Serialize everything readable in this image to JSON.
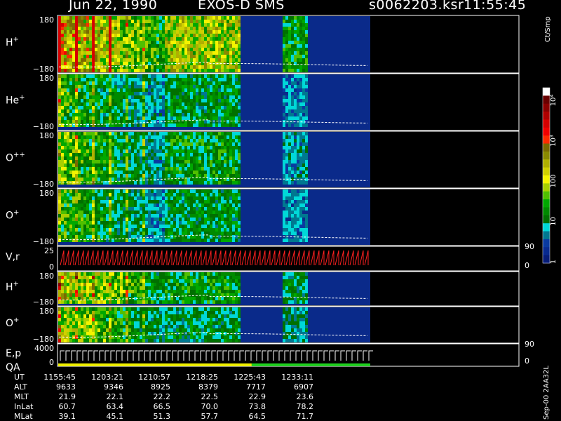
{
  "header": {
    "date": "Jun 22, 1990",
    "instrument": "EXOS-D SMS",
    "file": "s0062203.ksr",
    "time": "11:55:45"
  },
  "colorbar": {
    "title": "Ct/Smp",
    "tick_labels": [
      "10⁴",
      "10³",
      "100",
      "10",
      "1"
    ],
    "colors": [
      "#ffffff",
      "#6a0000",
      "#8a0000",
      "#b00000",
      "#d60000",
      "#f20000",
      "#ff2a00",
      "#7a6a00",
      "#8a8a00",
      "#b0b000",
      "#d0d000",
      "#f4f400",
      "#a8d000",
      "#50c000",
      "#00a800",
      "#008a00",
      "#007000",
      "#00d8d8",
      "#007890",
      "#0a3aa0",
      "#082a90",
      "#061c78"
    ]
  },
  "colors": {
    "background": "#0a2a8a",
    "dark_blue": "#10106a",
    "navy": "#081868",
    "trace": "#ffffff",
    "vr_trace": "#ff2020",
    "qa_yellow": "#f0f000",
    "qa_green": "#20d020"
  },
  "chart_data": {
    "type": "heatmap",
    "panels": [
      {
        "label": "H",
        "superscript": "+",
        "ytop": "180",
        "ybot": "−180",
        "kind": "spectro",
        "activity": 1.0
      },
      {
        "label": "He",
        "superscript": "+",
        "ytop": "180",
        "ybot": "−180",
        "kind": "spectro",
        "activity": 0.55
      },
      {
        "label": "O",
        "superscript": "++",
        "ytop": "180",
        "ybot": "−180",
        "kind": "spectro",
        "activity": 0.6
      },
      {
        "label": "O",
        "superscript": "+",
        "ytop": "180",
        "ybot": "−180",
        "kind": "spectro",
        "activity": 0.55
      },
      {
        "label": "V,r",
        "superscript": "",
        "ytop": "25",
        "ybot": "0",
        "kind": "vr",
        "activity": 0
      },
      {
        "label": "H",
        "superscript": "+",
        "ytop": "180",
        "ybot": "−180",
        "kind": "spectro2",
        "activity": 0.85
      },
      {
        "label": "O",
        "superscript": "+",
        "ytop": "180",
        "ybot": "−180",
        "kind": "spectro2",
        "activity": 0.7
      },
      {
        "label": "E,p",
        "label2": "QA",
        "superscript": "",
        "ytop": "4000",
        "ybot": "0",
        "kind": "ep",
        "activity": 0
      }
    ],
    "right_axis_labels": [
      {
        "panel": 4,
        "top": "90",
        "bottom": "0"
      },
      {
        "panel": 7,
        "top": "90",
        "bottom": "0"
      }
    ],
    "ephemeris": {
      "row_labels": [
        "UT",
        "ALT",
        "MLT",
        "InLat",
        "MLat"
      ],
      "columns": [
        [
          "1155:45",
          "9633",
          "21.9",
          "60.7",
          "39.1"
        ],
        [
          "1203:21",
          "9346",
          "22.1",
          "63.4",
          "45.1"
        ],
        [
          "1210:57",
          "8925",
          "22.2",
          "66.5",
          "51.3"
        ],
        [
          "1218:25",
          "8379",
          "22.5",
          "70.0",
          "57.7"
        ],
        [
          "1225:43",
          "7717",
          "22.9",
          "73.8",
          "64.5"
        ],
        [
          "1233:11",
          "6907",
          "23.6",
          "78.2",
          "71.7"
        ]
      ]
    },
    "footer": "Sep-00  2AA32L"
  }
}
